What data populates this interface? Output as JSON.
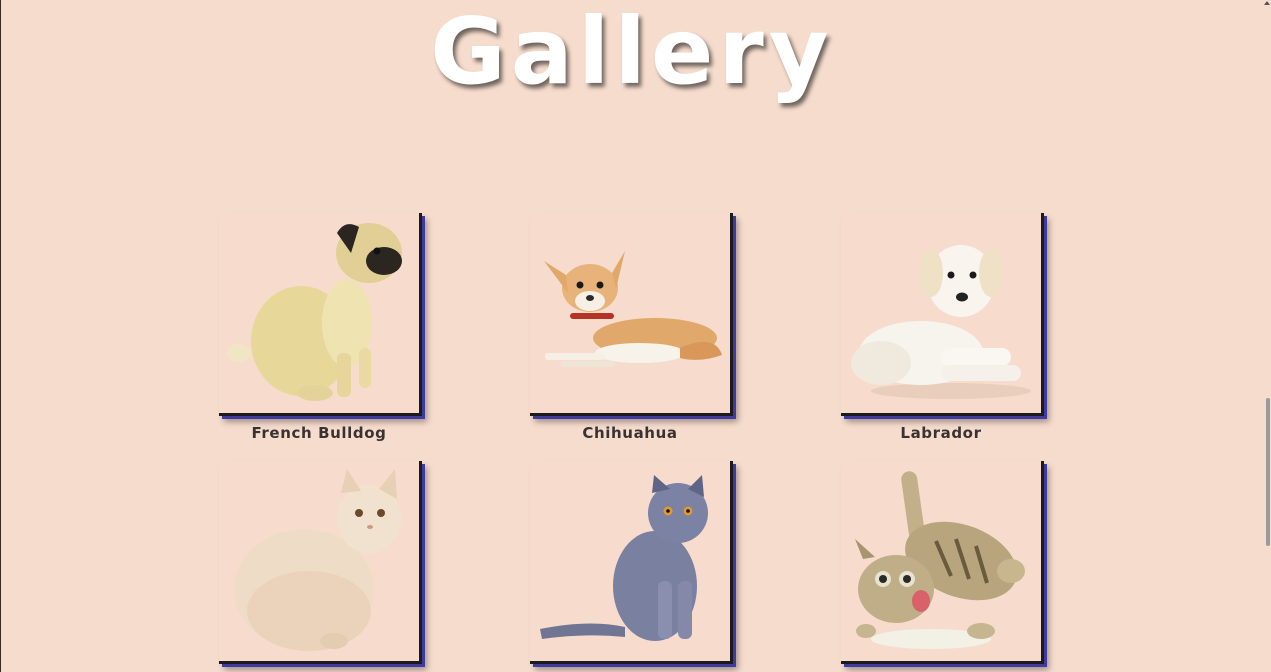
{
  "page": {
    "title": "Gallery"
  },
  "gallery": {
    "items": [
      {
        "caption": "French Bulldog",
        "icon": "pug-photo"
      },
      {
        "caption": "Chihuahua",
        "icon": "chihuahua-photo"
      },
      {
        "caption": "Labrador",
        "icon": "labrador-photo"
      },
      {
        "caption": "",
        "icon": "white-persian-cat-photo"
      },
      {
        "caption": "",
        "icon": "grey-british-cat-photo"
      },
      {
        "caption": "",
        "icon": "tabby-kitten-photo"
      }
    ]
  },
  "colors": {
    "background": "#f6dccd",
    "title": "#ffffff",
    "card_shadow": "#3f3aa0",
    "caption": "#3a3232"
  }
}
